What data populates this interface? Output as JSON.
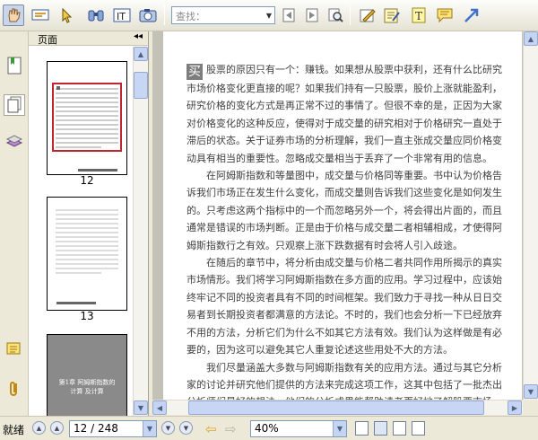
{
  "toolbar": {
    "find_placeholder": "查找：",
    "buttons": [
      "hand-tool",
      "select-text",
      "select-arrow",
      "binoculars",
      "text-select",
      "snapshot",
      "prev-find",
      "next-find",
      "find-search",
      "comment-tool",
      "note",
      "text-box",
      "callout",
      "arrow-tool"
    ]
  },
  "sidebar": {
    "title": "页面",
    "collapse": "◂◂",
    "thumbnails": [
      {
        "label": "12",
        "selected": true
      },
      {
        "label": "13",
        "selected": false
      },
      {
        "label": "",
        "selected": false
      }
    ],
    "thumb3_text": "第1章 阿姆斯指数的计算 及计算"
  },
  "document": {
    "dropcap": "买",
    "first_line": "股票的原因只有一个：赚钱。如果想从股票中获利，还有什么比研究市场价格变化更直接的呢？如果我们持有一只股票，股价上涨就能盈利，研究价格的变化方式是再正常不过的事情了。但很不幸的是，正因为大家对价格变化的这种反应，使得对于成交量的研究相对于价格研究一直处于滞后的状态。关于证券市场的分析理解，我们一直主张成交量应同价格变动具有相当的重要性。忽略成交量相当于丢弃了一个非常有用的信息。",
    "paragraphs": [
      "在阿姆斯指数和等量图中，成交量与价格同等重要。书中认为价格告诉我们市场正在发生什么变化，而成交量则告诉我们这些变化是如何发生的。只考虑这两个指标中的一个而忽略另外一个，将会得出片面的，而且通常是错误的市场判断。正是由于价格与成交量二者相辅相成，才使得阿姆斯指数行之有效。只观察上涨下跌数据有时会将人引入歧途。",
      "在随后的章节中，将分析由成交量与价格二者共同作用所揭示的真实市场情形。我们将学习阿姆斯指数在多方面的应用。学习过程中，应该始终牢记不同的投资者具有不同的时间框架。我们致力于寻找一种从日日交易者到长期投资者都满意的方法论。不时的，我们也会分析一下已经放弃不用的方法，分析它们为什么不如其它方法有效。我们认为这样做是有必要的，因为这可以避免其它人重复论述这些用处不大的方法。",
      "我们尽量涵盖大多数与阿姆斯指数有关的应用方法。通过与其它分析家的讨论并研究他们提供的方法来完成这项工作，这其中包括了一批杰出分析师们最好的想法。他们的分析成果能帮助读者更好地了解股票市场，并因此作出正确的决策。"
    ]
  },
  "status": {
    "ready": "就绪",
    "page_field": "12 / 248",
    "zoom_field": "40%"
  }
}
